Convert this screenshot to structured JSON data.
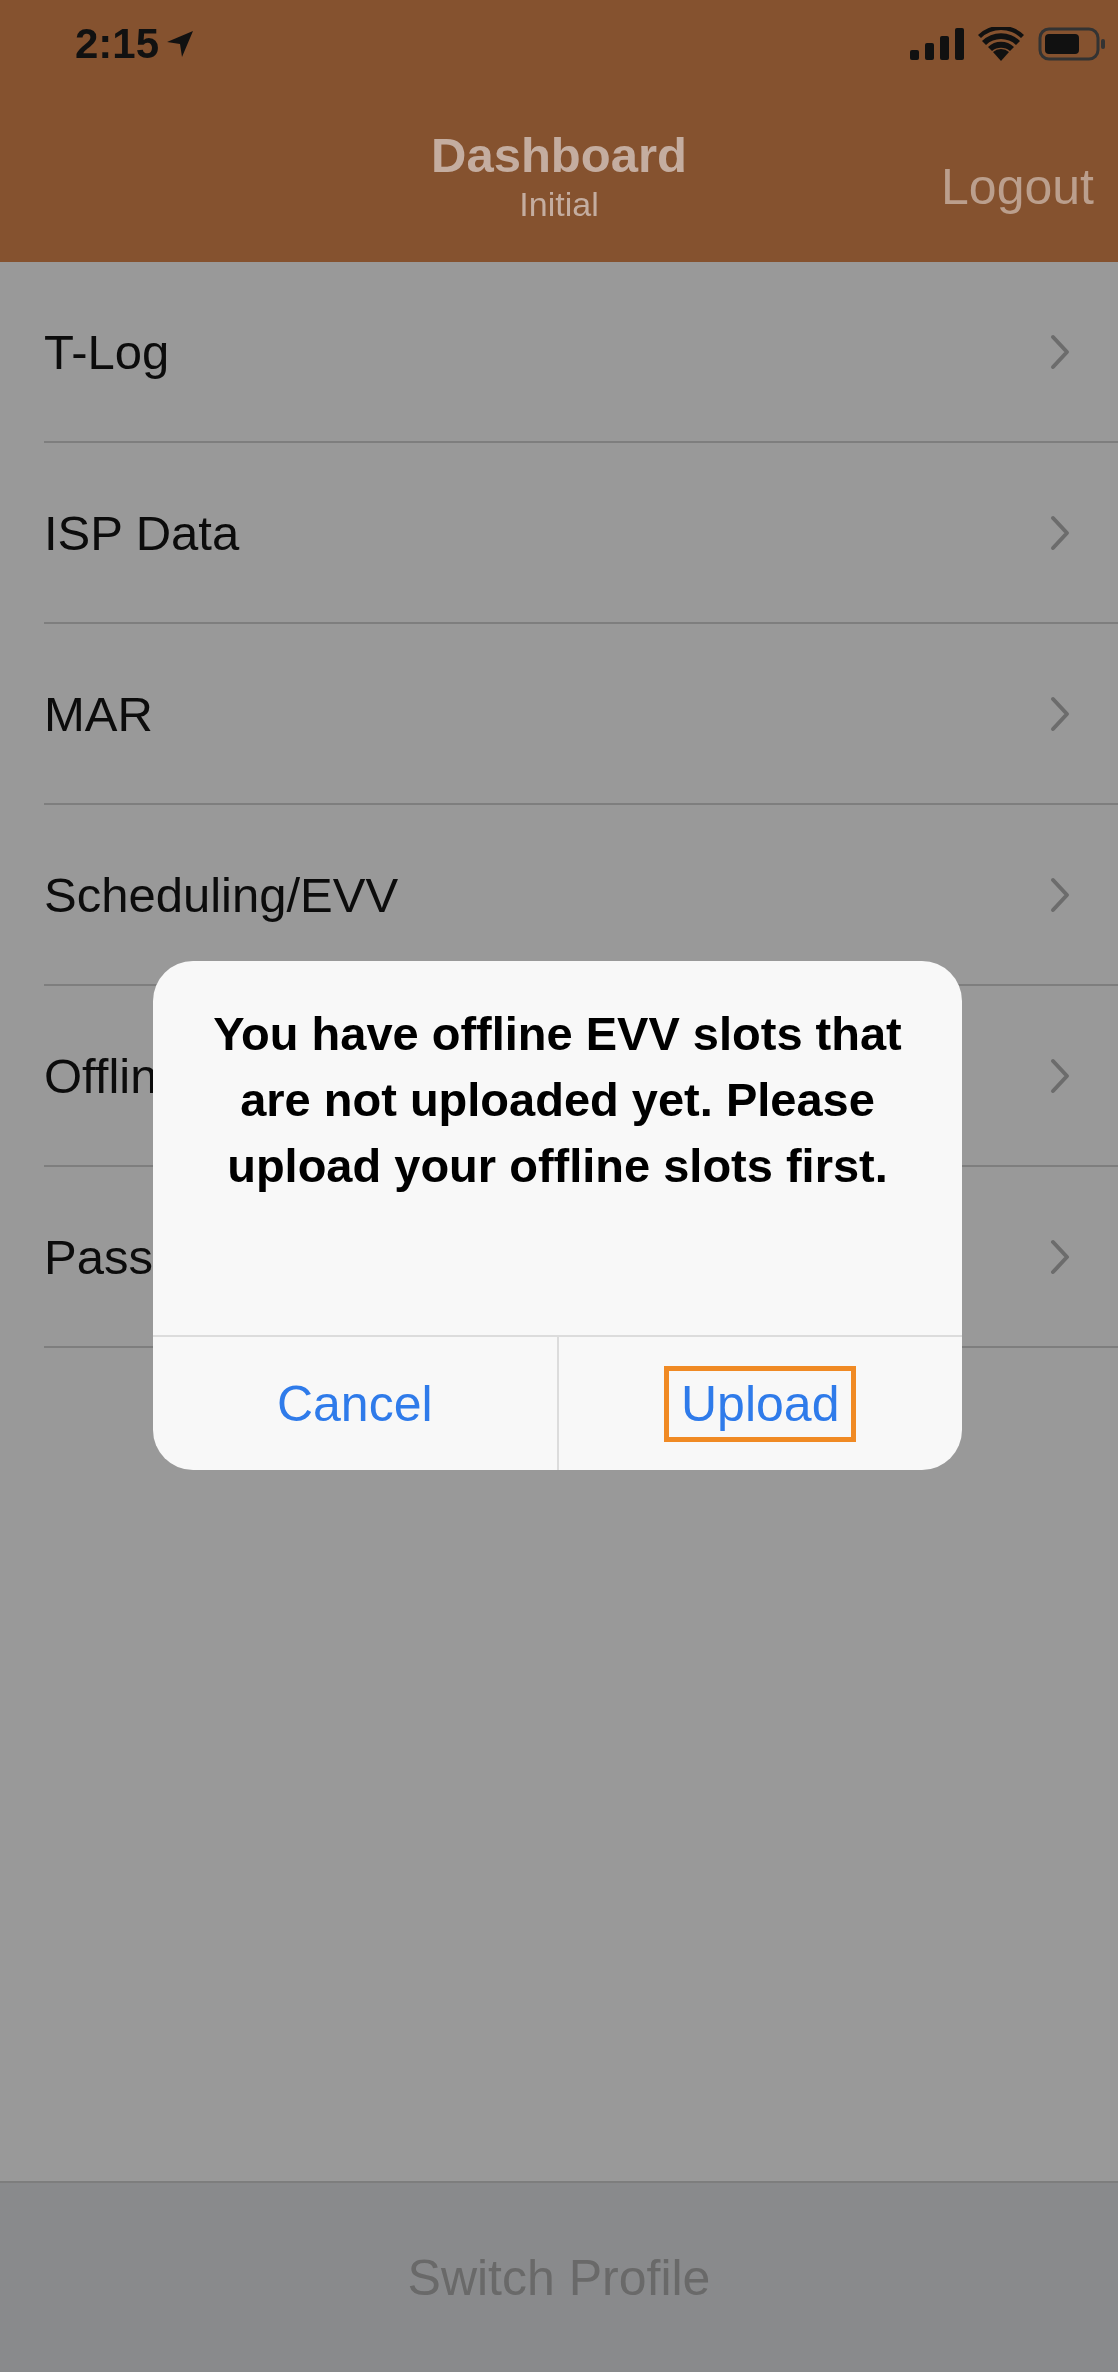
{
  "status_bar": {
    "time": "2:15"
  },
  "nav_bar": {
    "title": "Dashboard",
    "subtitle": "Initial",
    "right_button": "Logout"
  },
  "menu": [
    {
      "label": "T-Log"
    },
    {
      "label": "ISP Data"
    },
    {
      "label": "MAR"
    },
    {
      "label": "Scheduling/EVV"
    },
    {
      "label": "Offlin"
    },
    {
      "label": "Pass"
    }
  ],
  "alert": {
    "message": "You have offline EVV slots that are not uploaded yet. Please upload your offline slots first.",
    "buttons": [
      {
        "label": "Cancel",
        "highlighted": false
      },
      {
        "label": "Upload",
        "highlighted": true
      }
    ]
  },
  "bottom_bar": {
    "button": "Switch Profile"
  }
}
